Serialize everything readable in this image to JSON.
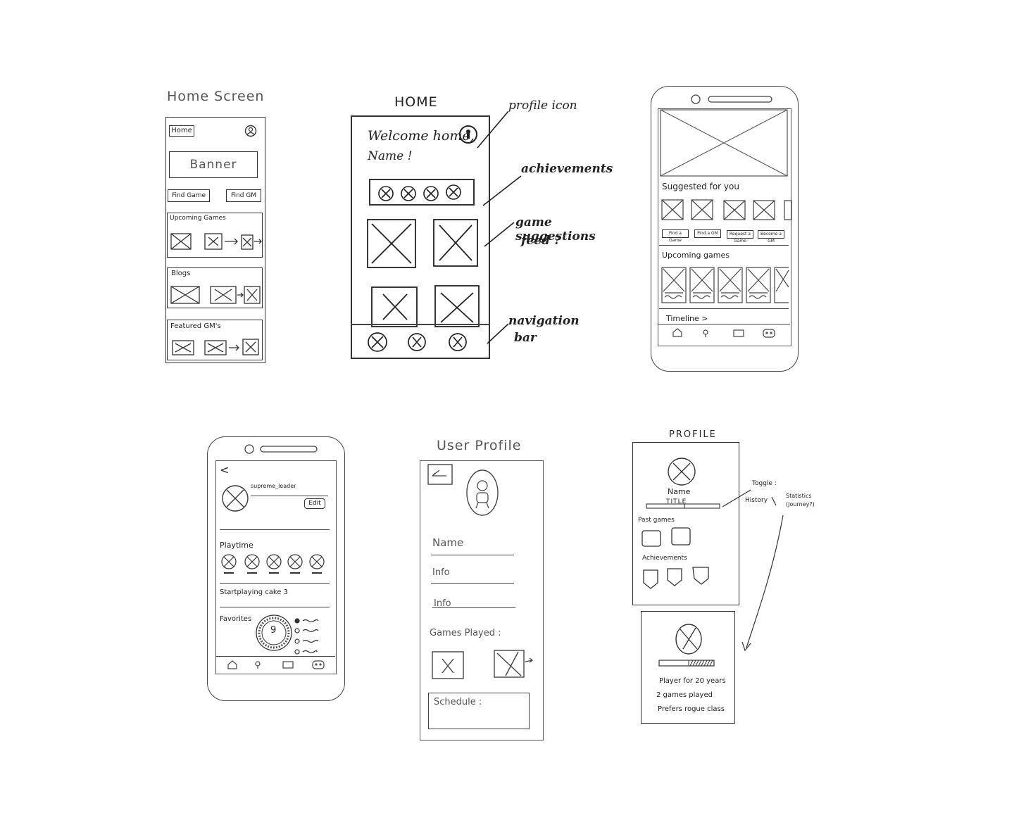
{
  "sketch1": {
    "title": "Home Screen",
    "home_tab": "Home",
    "banner": "Banner",
    "find_game": "Find Game",
    "find_gm": "Find GM",
    "upcoming_games": "Upcoming Games",
    "blogs": "Blogs",
    "featured_gms": "Featured GM's"
  },
  "sketch2": {
    "title": "HOME",
    "welcome": "Welcome home,",
    "name": "Name !",
    "annotations": {
      "profile_icon": "profile icon",
      "achievements": "achievements",
      "suggestions_1": "game suggestions",
      "suggestions_2": "feed ?",
      "navigation_1": "navigation",
      "navigation_2": "bar"
    }
  },
  "sketch3": {
    "suggested": "Suggested  for you",
    "buttons": [
      "Find a Game",
      "Find a GM",
      "Request a Game",
      "Become a GM"
    ],
    "upcoming": "Upcoming games",
    "timeline": "Timeline >"
  },
  "sketch4": {
    "back": "<",
    "username": "supreme_leader",
    "edit": "Edit",
    "playtime": "Playtime",
    "start_playing": "Startplaying cake 3",
    "favorites": "Favorites",
    "dial_value": "9"
  },
  "sketch5": {
    "title": "User  Profile",
    "name": "Name",
    "info_1": "Info",
    "info_2": "Info",
    "games_played": "Games  Played :",
    "schedule": "Schedule :"
  },
  "sketch6": {
    "title": "PROFILE",
    "name": "Name",
    "title_label": "TITLE",
    "toggle": "Toggle :",
    "history": "History",
    "statistics": "Statistics",
    "journey": "(Journey?)",
    "past_games": "Past games",
    "achievements": "Achievements",
    "stat_1": "Player for 20 years",
    "stat_2": "2 games played",
    "stat_3": "Prefers rogue class"
  }
}
